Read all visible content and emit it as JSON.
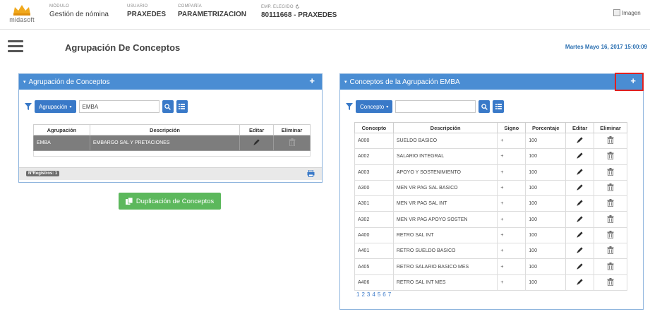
{
  "header": {
    "brand": "midasoft",
    "modulo_label": "MÓDULO",
    "modulo_value": "Gestión de nómina",
    "usuario_label": "USUARIO",
    "usuario_value": "PRAXEDES",
    "compania_label": "COMPAÑÍA",
    "compania_value": "PARAMETRIZACION",
    "empleado_label": "EMP. ELEGIDO",
    "empleado_value": "80111668 - PRAXEDES",
    "broken_image_alt": "Imagen"
  },
  "subheader": {
    "title": "Agrupación De Conceptos",
    "datetime": "Martes Mayo 16, 2017 15:00:09"
  },
  "left_panel": {
    "title": "Agrupación de Conceptos",
    "filter_button": "Agrupación",
    "filter_value": "EMBA",
    "columns": [
      "Agrupación",
      "Descripción",
      "Editar",
      "Eliminar"
    ],
    "rows": [
      {
        "agrupacion": "EMBA",
        "descripcion": "EMBARGO SAL Y PRETACIONES"
      }
    ],
    "record_count": "NºRegistros: 1"
  },
  "duplicate_button": "Duplicación de Conceptos",
  "right_panel": {
    "title": "Conceptos de la Agrupación EMBA",
    "filter_button": "Concepto",
    "filter_value": "",
    "columns": [
      "Concepto",
      "Descripción",
      "Signo",
      "Porcentaje",
      "Editar",
      "Eliminar"
    ],
    "rows": [
      {
        "concepto": "A000",
        "descripcion": "SUELDO BASICO",
        "signo": "+",
        "porcentaje": "100"
      },
      {
        "concepto": "A002",
        "descripcion": "SALARIO INTEGRAL",
        "signo": "+",
        "porcentaje": "100"
      },
      {
        "concepto": "A003",
        "descripcion": "APOYO Y SOSTENIMIENTO",
        "signo": "+",
        "porcentaje": "100"
      },
      {
        "concepto": "A300",
        "descripcion": "MEN VR PAG SAL BASICO",
        "signo": "+",
        "porcentaje": "100"
      },
      {
        "concepto": "A301",
        "descripcion": "MEN VR PAG SAL INT",
        "signo": "+",
        "porcentaje": "100"
      },
      {
        "concepto": "A302",
        "descripcion": "MEN VR PAG APOYO SOSTEN",
        "signo": "+",
        "porcentaje": "100"
      },
      {
        "concepto": "A400",
        "descripcion": "RETRO SAL INT",
        "signo": "+",
        "porcentaje": "100"
      },
      {
        "concepto": "A401",
        "descripcion": "RETRO SUELDO BASICO",
        "signo": "+",
        "porcentaje": "100"
      },
      {
        "concepto": "A405",
        "descripcion": "RETRO SALARIO BASICO MES",
        "signo": "+",
        "porcentaje": "100"
      },
      {
        "concepto": "A406",
        "descripcion": "RETRO SAL INT MES",
        "signo": "+",
        "porcentaje": "100"
      }
    ],
    "pages": [
      "1",
      "2",
      "3",
      "4",
      "5",
      "6",
      "7"
    ]
  },
  "icons": {
    "search": "search-icon",
    "list": "list-icon",
    "edit": "pencil-icon",
    "delete": "trash-icon",
    "print": "print-icon",
    "add": "plus-icon",
    "filter": "funnel-icon",
    "menu": "hamburger-icon",
    "refresh": "refresh-icon",
    "copy": "copy-icon"
  },
  "colors": {
    "primary": "#4a8dd3",
    "button": "#3979c8",
    "success": "#5cb85c",
    "selected_row": "#7d7d7d",
    "highlight": "#e02020"
  }
}
